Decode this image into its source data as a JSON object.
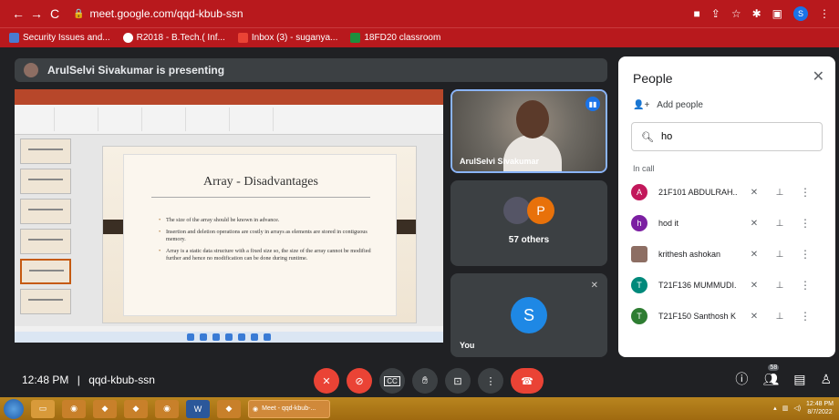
{
  "browser": {
    "url": "meet.google.com/qqd-kbub-ssn",
    "bookmarks": [
      {
        "label": "Security Issues and...",
        "color": "#4a7bd0"
      },
      {
        "label": "R2018 - B.Tech.( Inf...",
        "color": "#ffffff"
      },
      {
        "label": "Inbox (3) - suganya...",
        "color": "#ea4335"
      },
      {
        "label": "18FD20 classroom",
        "color": "#1e8e3e"
      }
    ],
    "profile_initial": "S"
  },
  "meet": {
    "presenting_text": "ArulSelvi Sivakumar is presenting",
    "slide": {
      "title": "Array - Disadvantages",
      "bullets": [
        "The size of the array should be known in advance.",
        "Insertion and deletion operations are costly in arrays as elements are stored in contiguous memory.",
        "Array is a static data structure with a fixed size so, the size of the array cannot be modified further and hence no modification can be done during runtime."
      ]
    },
    "tiles": {
      "presenter_name": "ArulSelvi Sivakumar",
      "others_initial": "P",
      "others_label": "57 others",
      "you_initial": "S",
      "you_label": "You"
    },
    "people": {
      "title": "People",
      "add_people": "Add people",
      "search_value": "ho",
      "in_call_label": "In call",
      "participants": [
        {
          "initial": "A",
          "name": "21F101 ABDULRAH...",
          "color": "#c2185b"
        },
        {
          "initial": "h",
          "name": "hod it",
          "color": "#7b1fa2"
        },
        {
          "initial": "",
          "name": "krithesh ashokan",
          "color": "#8d6e63"
        },
        {
          "initial": "T",
          "name": "T21F136 MUMMUDI...",
          "color": "#00897b"
        },
        {
          "initial": "T",
          "name": "T21F150 Santhosh K",
          "color": "#2e7d32"
        }
      ]
    },
    "bottom": {
      "time": "12:48 PM",
      "separator": "|",
      "meeting_code": "qqd-kbub-ssn",
      "participant_count": "58",
      "cc_label": "CC"
    }
  },
  "taskbar": {
    "meet_tab": "Meet - qqd-kbub-...",
    "clock_time": "12:48 PM",
    "clock_date": "8/7/2022"
  }
}
